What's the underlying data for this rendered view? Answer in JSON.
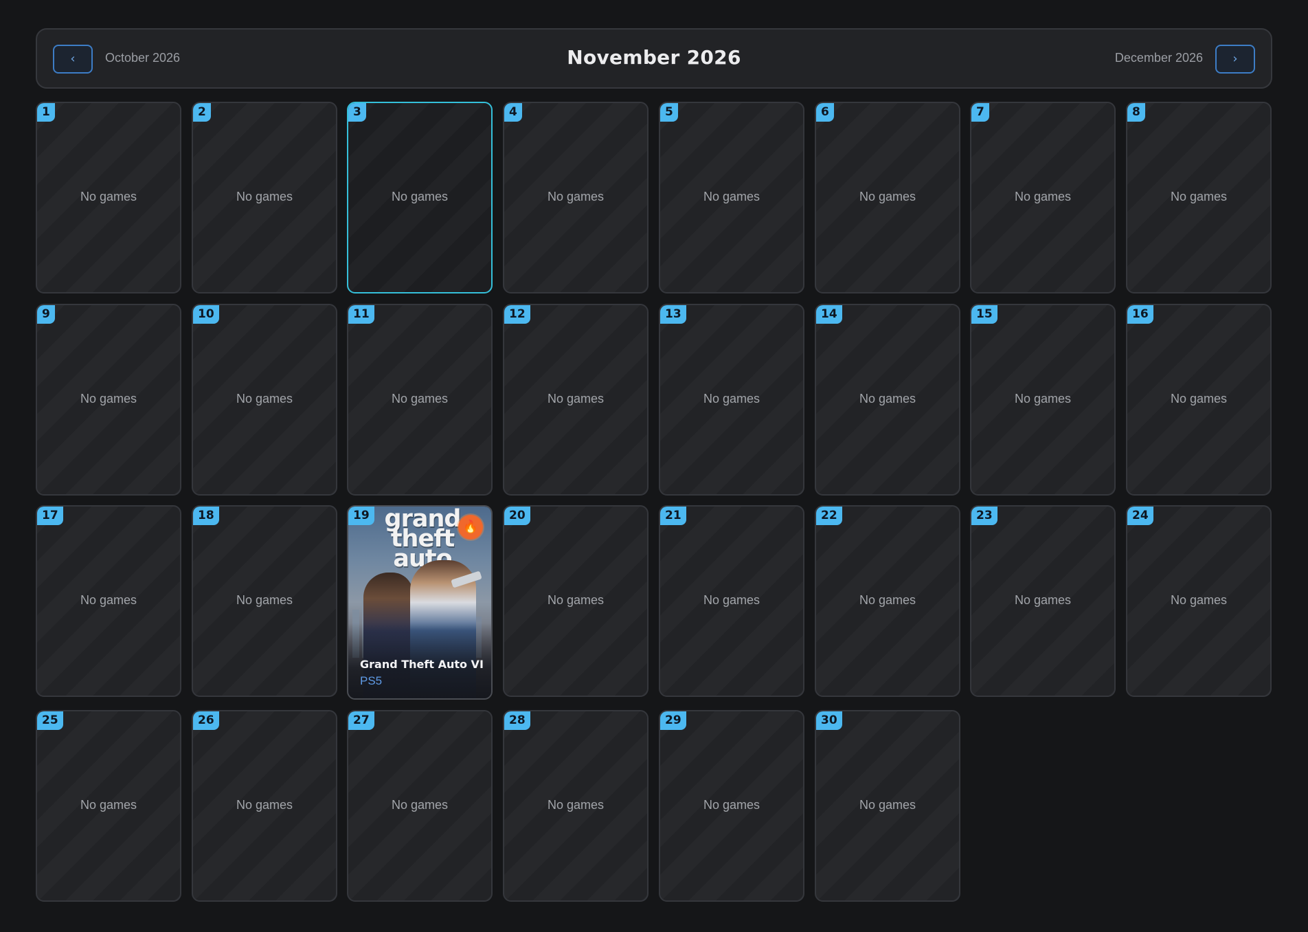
{
  "header": {
    "title": "November 2026",
    "prev_label": "October 2026",
    "next_label": "December 2026",
    "prev_icon": "chevron-left-icon",
    "next_icon": "chevron-right-icon"
  },
  "colors": {
    "accent": "#4cb8f0",
    "selected_border": "#35c0da",
    "hot": "#f0682c",
    "platform": "#5f9be6"
  },
  "empty_label": "No games",
  "selected_day": "3",
  "days": [
    {
      "day": "1"
    },
    {
      "day": "2"
    },
    {
      "day": "3"
    },
    {
      "day": "4"
    },
    {
      "day": "5"
    },
    {
      "day": "6"
    },
    {
      "day": "7"
    },
    {
      "day": "8"
    },
    {
      "day": "9"
    },
    {
      "day": "10"
    },
    {
      "day": "11"
    },
    {
      "day": "12"
    },
    {
      "day": "13"
    },
    {
      "day": "14"
    },
    {
      "day": "15"
    },
    {
      "day": "16"
    },
    {
      "day": "17"
    },
    {
      "day": "18"
    },
    {
      "day": "19",
      "game": {
        "title": "Grand Theft Auto VI",
        "platform": "PS5",
        "logo_text": "grand theft auto",
        "badge_icon": "flame-icon"
      }
    },
    {
      "day": "20"
    },
    {
      "day": "21"
    },
    {
      "day": "22"
    },
    {
      "day": "23"
    },
    {
      "day": "24"
    },
    {
      "day": "25"
    },
    {
      "day": "26"
    },
    {
      "day": "27"
    },
    {
      "day": "28"
    },
    {
      "day": "29"
    },
    {
      "day": "30"
    }
  ]
}
